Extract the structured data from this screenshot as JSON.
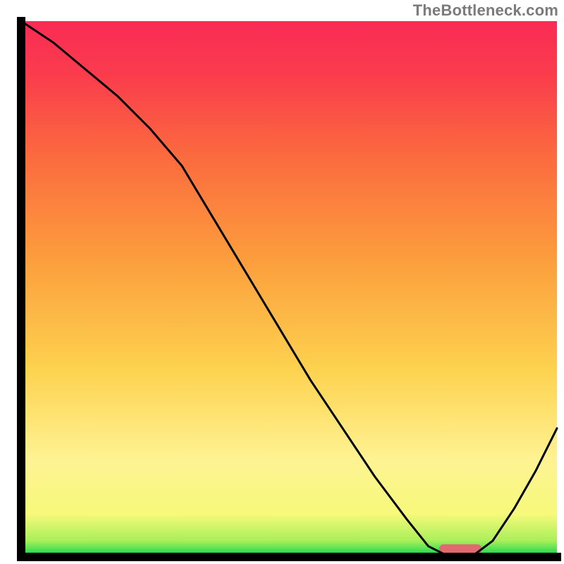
{
  "watermark": "TheBottleneck.com",
  "chart_data": {
    "type": "line",
    "title": "",
    "xlabel": "",
    "ylabel": "",
    "xlim": [
      0,
      100
    ],
    "ylim": [
      0,
      100
    ],
    "series": [
      {
        "name": "curve",
        "x": [
          0,
          6,
          12,
          18,
          24,
          30,
          36,
          42,
          48,
          54,
          60,
          66,
          72,
          76,
          80,
          84,
          88,
          92,
          96,
          100
        ],
        "y": [
          100,
          96,
          91,
          86,
          80,
          73,
          63,
          53,
          43,
          33,
          24,
          15,
          7,
          2,
          0,
          0,
          3,
          9,
          16,
          24
        ]
      }
    ],
    "highlight_bar": {
      "x_start": 78,
      "x_end": 86,
      "y": 1.5
    },
    "gradient_stops": [
      {
        "offset": 0.0,
        "color": "#00d64e"
      },
      {
        "offset": 0.03,
        "color": "#a8ef5a"
      },
      {
        "offset": 0.08,
        "color": "#f6f97a"
      },
      {
        "offset": 0.18,
        "color": "#fef393"
      },
      {
        "offset": 0.35,
        "color": "#fdd24f"
      },
      {
        "offset": 0.55,
        "color": "#fc9f3d"
      },
      {
        "offset": 0.75,
        "color": "#fb6a3e"
      },
      {
        "offset": 0.9,
        "color": "#fa3c4d"
      },
      {
        "offset": 1.0,
        "color": "#fa2b55"
      }
    ],
    "frame_color": "#000000",
    "curve_color": "#000000",
    "highlight_color": "#e06a6f"
  }
}
